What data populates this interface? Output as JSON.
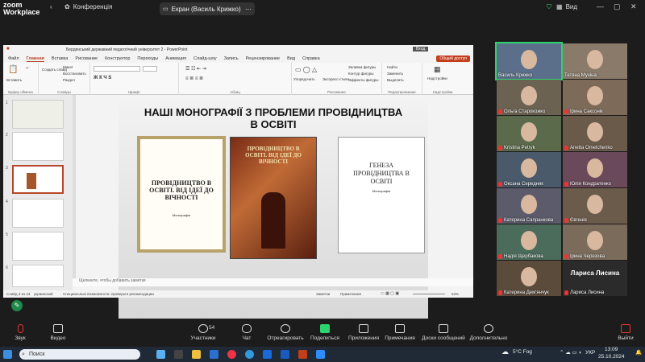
{
  "app": {
    "logo_line1": "zoom",
    "logo_line2": "Workplace",
    "conference_label": "Конференція",
    "screen_share_label": "Екран (Василь Крижко)",
    "view_label": "Вид"
  },
  "powerpoint": {
    "window_title": "Бердянський державний педагогічний університет 2 - PowerPoint",
    "mode_label": "Вход",
    "menu": [
      "Файл",
      "Главная",
      "Вставка",
      "Рисование",
      "Конструктор",
      "Переходы",
      "Анимация",
      "Слайд-шоу",
      "Запись",
      "Рецензирование",
      "Вид",
      "Справка"
    ],
    "active_menu": "Главная",
    "share_button": "Общий доступ",
    "ribbon_groups": [
      "Буфер обмена",
      "Слайды",
      "Шрифт",
      "Абзац",
      "Рисование",
      "Редактирование",
      "Надстройки"
    ],
    "ribbon_items": {
      "paste": "Вставить",
      "create_slide": "Создать слайд",
      "layout": "Макет",
      "reset": "Восстановить",
      "section": "Раздел",
      "arrange": "Упорядочить",
      "quick_styles": "Экспресс-стили",
      "fill": "Заливка фигуры",
      "outline": "Контур фигуры",
      "effects": "Эффекты фигуры",
      "find": "Найти",
      "replace": "Заменить",
      "select": "Выделить",
      "addins": "Надстройки"
    },
    "slide_numbers": [
      "1",
      "2",
      "3",
      "4",
      "5",
      "6"
    ],
    "notes_placeholder": "Щелкните, чтобы добавить заметки",
    "status_left": "Слайд 3 из 23",
    "status_lang": "украинский",
    "status_accessibility": "Специальные возможности: проверьте рекомендации",
    "status_notes": "Заметки",
    "status_comments": "Примечания",
    "zoom_level": "53%"
  },
  "slide": {
    "title_line1": "НАШІ МОНОГРАФІЇ З ПРОБЛЕМИ ПРОВІДНИЦТВА",
    "title_line2": "В ОСВІТІ",
    "book1_title": "ПРОВІДНИЦТВО В ОСВІТІ. ВІД ІДЕЇ ДО ВІЧНОСТІ",
    "book1_sub": "Монографія",
    "book2_title": "ПРОВІДНИЦТВО В ОСВІТІ. ВІД ІДЕЇ ДО ВІЧНОСТІ",
    "book3_title": "ГЕНЕЗА ПРОВІДНИЦТВА В ОСВІТІ",
    "book3_sub": "Монографія"
  },
  "participants": [
    {
      "name": "Василь Крижко",
      "muted": false,
      "active": true
    },
    {
      "name": "Тетяна Мухіна",
      "muted": false,
      "active": false
    },
    {
      "name": "Ольга Старокожко",
      "muted": true,
      "active": false
    },
    {
      "name": "Ірина Саксонік",
      "muted": true,
      "active": false
    },
    {
      "name": "Kristina Petryk",
      "muted": true,
      "active": false
    },
    {
      "name": "Anetta Omelchenko",
      "muted": true,
      "active": false
    },
    {
      "name": "Оксана Середняк",
      "muted": true,
      "active": false
    },
    {
      "name": "Юлія Кондратенко",
      "muted": true,
      "active": false
    },
    {
      "name": "Катерина Сапранкова",
      "muted": true,
      "active": false
    },
    {
      "name": "Євгенія",
      "muted": true,
      "active": false
    },
    {
      "name": "Надія Щербакова",
      "muted": true,
      "active": false
    },
    {
      "name": "Ірина Черезова",
      "muted": true,
      "active": false
    },
    {
      "name": "Катерина Дем'янчук",
      "muted": true,
      "active": false
    },
    {
      "name": "Лариса Лисина",
      "muted": true,
      "active": false,
      "no_video_label": "Лариса Лисина"
    }
  ],
  "toolbar": {
    "mic": "Звук",
    "video": "Видео",
    "participants": "Участники",
    "participants_count": "54",
    "chat": "Чат",
    "react": "Отреагировать",
    "share": "Поделиться",
    "apps": "Приложения",
    "notes": "Примечания",
    "whiteboards": "Доски сообщений",
    "more": "Дополнительно",
    "leave": "Выйти"
  },
  "taskbar": {
    "search": "Поиск",
    "weather": "5°C Fog",
    "lang": "УКР",
    "time": "13:09",
    "date": "25.10.2024"
  },
  "colors": {
    "accent": "#b7472a",
    "zoom_bg": "#1c1c1c",
    "active_speaker": "#2dd36f",
    "muted": "#e33333"
  }
}
